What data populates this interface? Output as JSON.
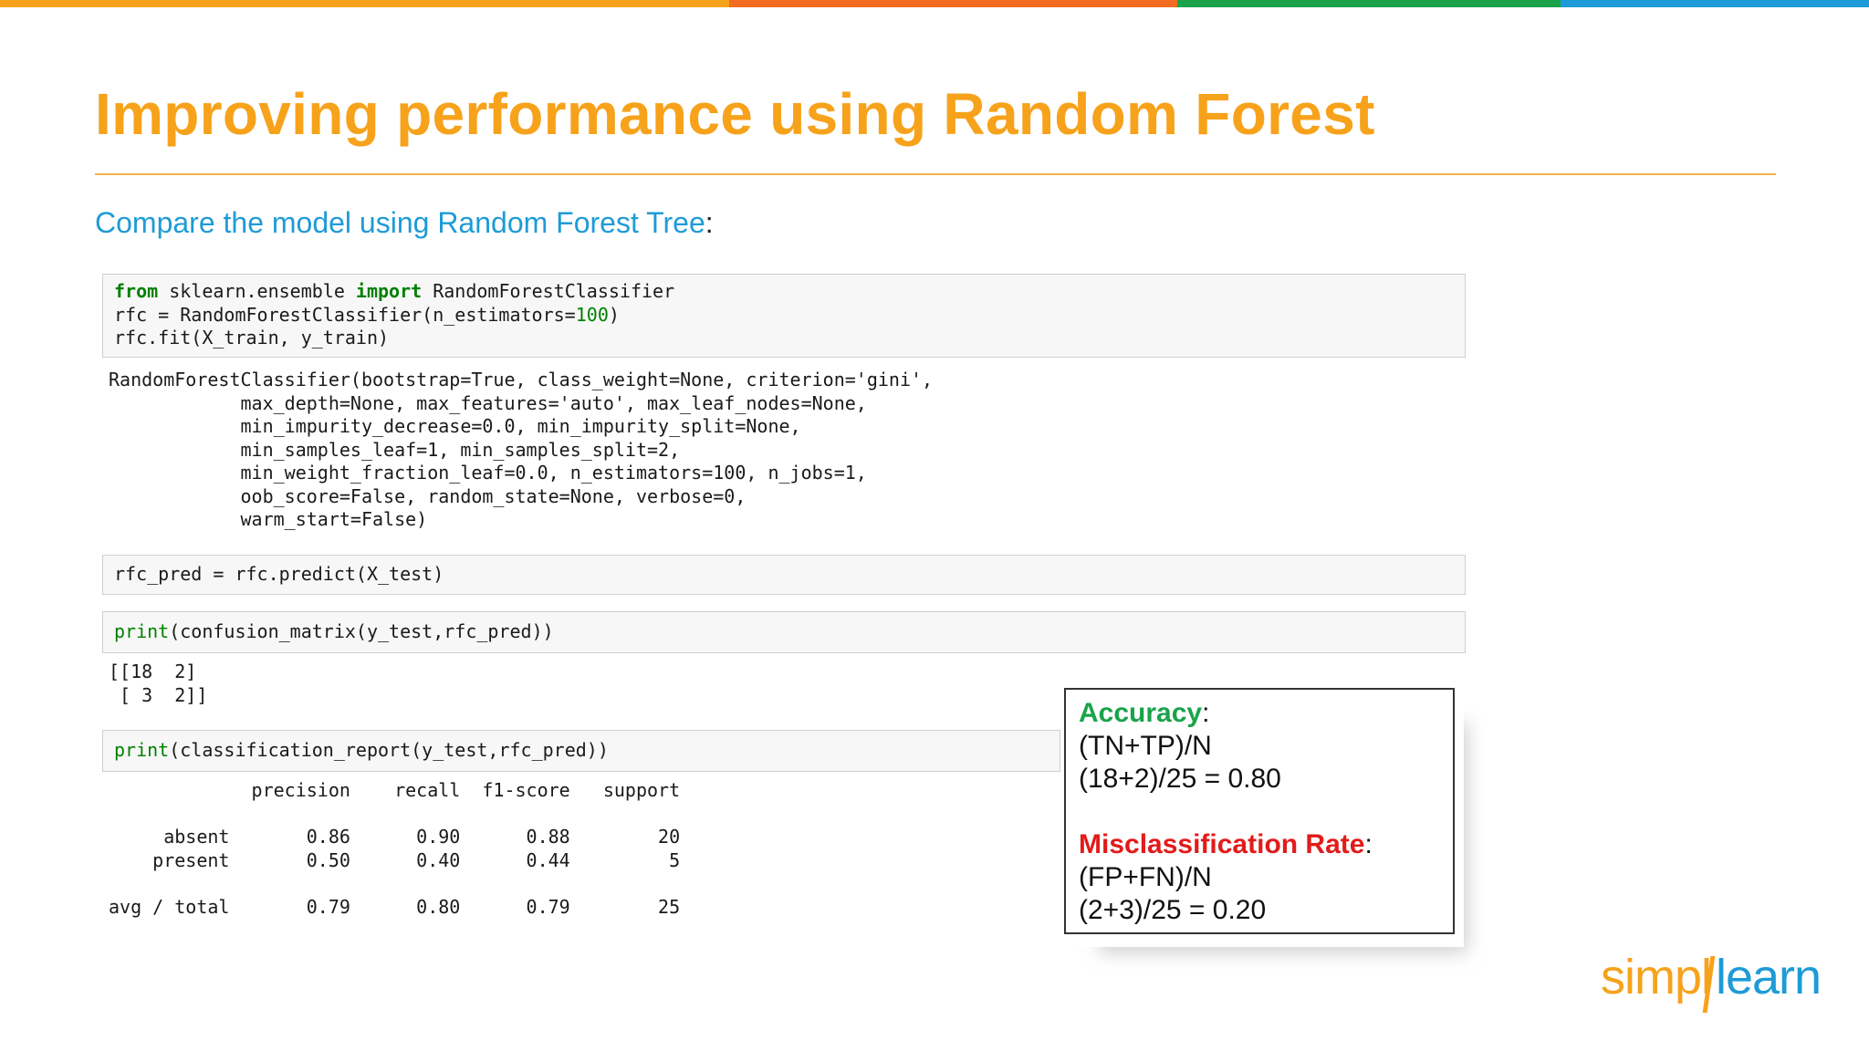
{
  "slide": {
    "title": "Improving performance using Random Forest",
    "subtitle": "Compare the model using Random Forest Tree",
    "subtitle_colon": ":",
    "colors": {
      "title": "#f7a21b",
      "subtitle": "#1e9bd7",
      "rule": "#f0b34a",
      "accuracy": "#1aa34a",
      "misclassification": "#e21b1b",
      "logo_orange": "#f7a21b",
      "logo_blue": "#1e9bd7"
    },
    "topbar_colors": [
      "#f7a21b",
      "#f26b21",
      "#1aa34a",
      "#1e9bd7"
    ],
    "topbar_fractions": [
      0.39,
      0.24,
      0.205,
      0.165
    ]
  },
  "code": {
    "cell1": {
      "line1": {
        "kw1": "from",
        "mod": " sklearn.ensemble ",
        "kw2": "import",
        "name": " RandomForestClassifier"
      },
      "line2": {
        "pre": "rfc = RandomForestClassifier(n_estimators=",
        "num": "100",
        "post": ")"
      },
      "line3": "rfc.fit(X_train, y_train)"
    },
    "output1": [
      "RandomForestClassifier(bootstrap=True, class_weight=None, criterion='gini',",
      "            max_depth=None, max_features='auto', max_leaf_nodes=None,",
      "            min_impurity_decrease=0.0, min_impurity_split=None,",
      "            min_samples_leaf=1, min_samples_split=2,",
      "            min_weight_fraction_leaf=0.0, n_estimators=100, n_jobs=1,",
      "            oob_score=False, random_state=None, verbose=0,",
      "            warm_start=False)"
    ],
    "cell2": "rfc_pred = rfc.predict(X_test)",
    "cell3": {
      "fn": "print",
      "args": "(confusion_matrix(y_test,rfc_pred))"
    },
    "output3": [
      "[[18  2]",
      " [ 3  2]]"
    ],
    "cell4": {
      "fn": "print",
      "args": "(classification_report(y_test,rfc_pred))"
    },
    "report": [
      "             precision    recall  f1-score   support",
      "",
      "     absent       0.86      0.90      0.88        20",
      "    present       0.50      0.40      0.44         5",
      "",
      "avg / total       0.79      0.80      0.79        25"
    ]
  },
  "callout": {
    "accuracy_label": "Accuracy",
    "accuracy_colon": ":",
    "accuracy_formula": "(TN+TP)/N",
    "accuracy_calc": "(18+2)/25 = 0.80",
    "misclass_label": "Misclassification Rate",
    "misclass_colon": ":",
    "misclass_formula": "(FP+FN)/N",
    "misclass_calc": "(2+3)/25 = 0.20"
  },
  "logo": {
    "part1": "simpl",
    "part2": "learn"
  }
}
